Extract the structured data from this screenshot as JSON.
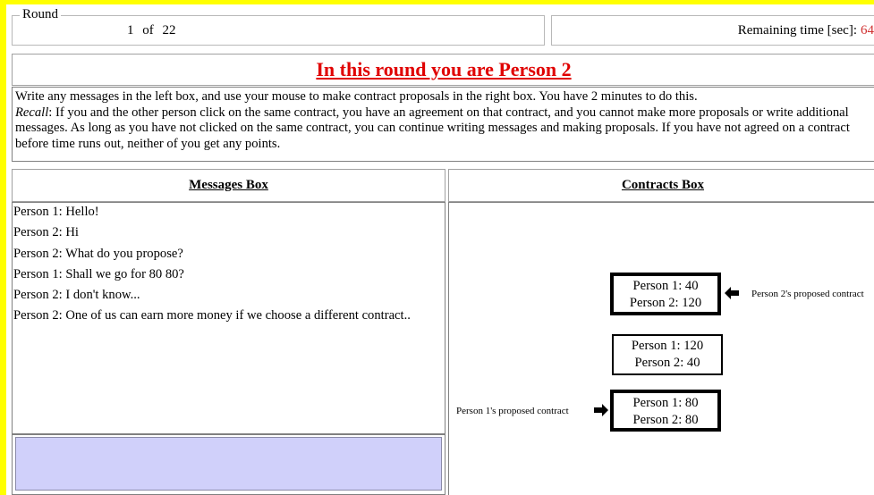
{
  "round": {
    "legend": "Round",
    "current": "1",
    "of": "of",
    "total": "22"
  },
  "timer": {
    "label": "Remaining time [sec]:",
    "value": "64"
  },
  "title": "In this round you are Person 2",
  "instructions": {
    "line1": "Write any messages in the left box, and use your mouse to make contract proposals in the right box. You have 2 minutes to do this.",
    "recall_label": "Recall",
    "recall_text": ": If you and the other person click on the same contract, you have an agreement on that contract, and you cannot make more proposals or write additional messages. As long as you have not clicked on the same contract, you can continue writing messages and making proposals. If you have not agreed on a contract before time runs out, neither of you get any points."
  },
  "messages_box": {
    "header": "Messages Box",
    "messages": [
      "Person 1: Hello!",
      "Person 2: Hi",
      "Person 2: What do you propose?",
      "Person 1: Shall we go for 80 80?",
      "Person 2: I don't know...",
      "Person 2: One of us can earn more money if we choose a different contract.."
    ],
    "input_value": ""
  },
  "contracts_box": {
    "header": "Contracts Box",
    "contracts": [
      {
        "p1": "Person 1: 40",
        "p2": "Person 2: 120"
      },
      {
        "p1": "Person 1: 120",
        "p2": "Person 2: 40"
      },
      {
        "p1": "Person 1: 80",
        "p2": "Person 2: 80"
      }
    ],
    "person2_proposal_label": "Person 2's proposed contract",
    "person1_proposal_label": "Person 1's proposed contract"
  },
  "colors": {
    "page_border": "#ffff00",
    "title_red": "#e00000",
    "timer_value": "#d03030",
    "input_bg": "#d0d0fa"
  },
  "icons": [
    "arrow-left-icon",
    "arrow-right-icon"
  ]
}
